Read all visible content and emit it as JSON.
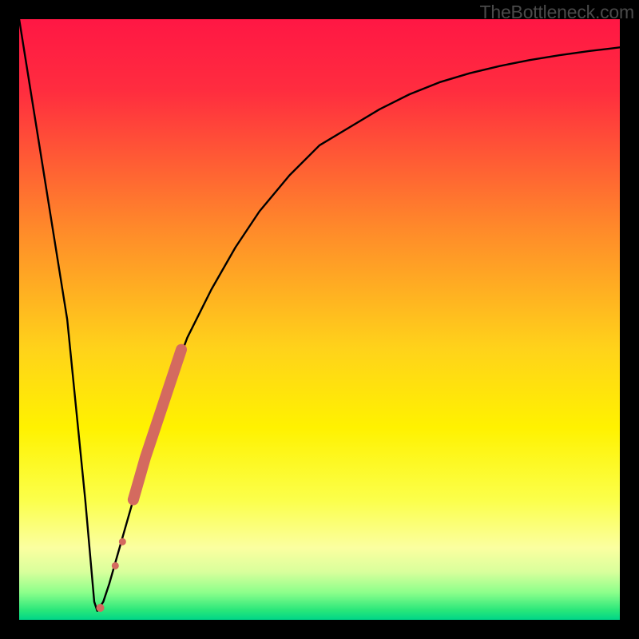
{
  "watermark": "TheBottleneck.com",
  "colors": {
    "frame": "#000000",
    "curve": "#000000",
    "marker": "#d46a5f",
    "gradient_stops": [
      {
        "offset": 0,
        "color": "#ff1744"
      },
      {
        "offset": 0.12,
        "color": "#ff2d3f"
      },
      {
        "offset": 0.35,
        "color": "#ff8a2a"
      },
      {
        "offset": 0.55,
        "color": "#ffd31a"
      },
      {
        "offset": 0.68,
        "color": "#fff200"
      },
      {
        "offset": 0.8,
        "color": "#fbff4a"
      },
      {
        "offset": 0.88,
        "color": "#fbffa0"
      },
      {
        "offset": 0.92,
        "color": "#d9ff9c"
      },
      {
        "offset": 0.955,
        "color": "#8bff8b"
      },
      {
        "offset": 0.985,
        "color": "#26e67a"
      },
      {
        "offset": 1.0,
        "color": "#00d588"
      }
    ]
  },
  "chart_data": {
    "type": "line",
    "title": "",
    "xlabel": "",
    "ylabel": "",
    "xlim": [
      0,
      100
    ],
    "ylim": [
      0,
      100
    ],
    "grid": false,
    "series": [
      {
        "name": "curve",
        "x": [
          0,
          4,
          8,
          11,
          12.5,
          13,
          14,
          15,
          17,
          19,
          22,
          25,
          28,
          32,
          36,
          40,
          45,
          50,
          55,
          60,
          65,
          70,
          75,
          80,
          85,
          90,
          95,
          100
        ],
        "values": [
          100,
          75,
          50,
          20,
          3,
          1.5,
          3,
          6,
          13,
          20,
          30,
          39,
          47,
          55,
          62,
          68,
          74,
          79,
          82,
          85,
          87.5,
          89.5,
          91,
          92.2,
          93.2,
          94,
          94.7,
          95.3
        ]
      }
    ],
    "highlight_segment": {
      "description": "thick salmon segment on ascending branch",
      "x": [
        19,
        20,
        21,
        22,
        23,
        24,
        25,
        26,
        27
      ],
      "values": [
        20,
        23.5,
        27,
        30,
        33,
        36,
        39,
        42,
        45
      ]
    },
    "markers": [
      {
        "x": 13.5,
        "y": 2,
        "r": 5
      },
      {
        "x": 16,
        "y": 9,
        "r": 4.5
      },
      {
        "x": 17.2,
        "y": 13,
        "r": 4.5
      }
    ]
  }
}
